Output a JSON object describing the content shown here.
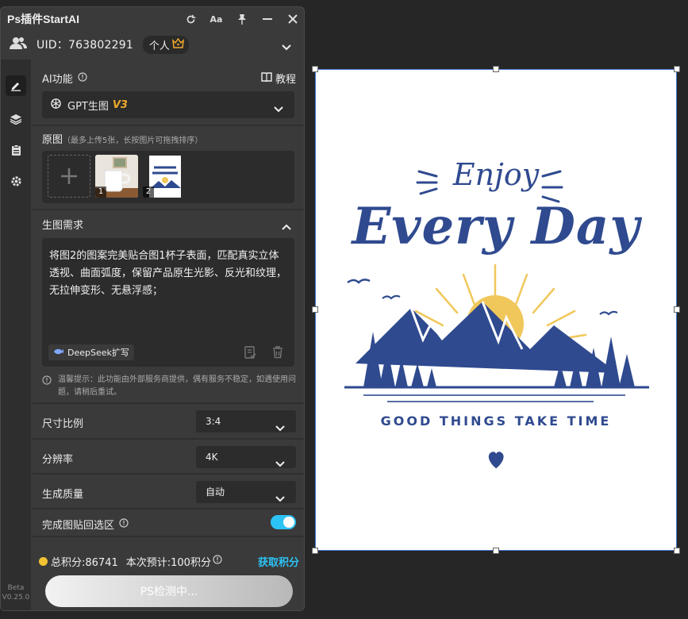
{
  "app": {
    "title": "Ps插件StartAI"
  },
  "titlebar_icons": [
    {
      "name": "refresh-icon",
      "glyph": "↻"
    },
    {
      "name": "font-size-icon",
      "glyph": "Aa"
    },
    {
      "name": "pin-icon",
      "glyph": "pin"
    },
    {
      "name": "minimize-icon",
      "glyph": "—"
    },
    {
      "name": "close-icon",
      "glyph": "✕"
    }
  ],
  "user": {
    "uid_label": "UID：763802291",
    "plan": "个人"
  },
  "sidebar": {
    "version": "Beta\nV0.25.0"
  },
  "ai_function": {
    "label": "AI功能",
    "tutorial": "教程",
    "model_name": "GPT生图",
    "model_version": "V3"
  },
  "source_images": {
    "label": "原图",
    "note": "（最多上传5张，长按图片可拖拽排序）",
    "items": [
      {
        "num": "1"
      },
      {
        "num": "2"
      }
    ]
  },
  "prompt": {
    "label": "生图需求",
    "text": "将图2的图案完美贴合图1杯子表面，匹配真实立体透视、曲面弧度，保留产品原生光影、反光和纹理，无拉伸变形、无悬浮感；",
    "deepseek_label": "DeepSeek扩写"
  },
  "tip": "温馨提示：此功能由外部服务商提供，偶有服务不稳定，如遇使用问题，请稍后重试。",
  "settings": {
    "aspect": {
      "label": "尺寸比例",
      "value": "3:4"
    },
    "resolution": {
      "label": "分辨率",
      "value": "4K"
    },
    "quality": {
      "label": "生成质量",
      "value": "自动"
    },
    "paste_back": {
      "label": "完成图贴回选区",
      "enabled": true
    }
  },
  "points": {
    "total": "总积分:86741",
    "estimate": "本次预计:100积分",
    "get": "获取积分"
  },
  "action_button": "PS检测中...",
  "canvas_artwork": {
    "line1": "Enjoy",
    "line2": "Every Day",
    "tagline": "GOOD THINGS TAKE TIME"
  },
  "colors": {
    "accent": "#2cc3f5",
    "brand_orange": "#f0a92a",
    "art_blue": "#2f4a8f",
    "sun": "#f0c75a"
  }
}
